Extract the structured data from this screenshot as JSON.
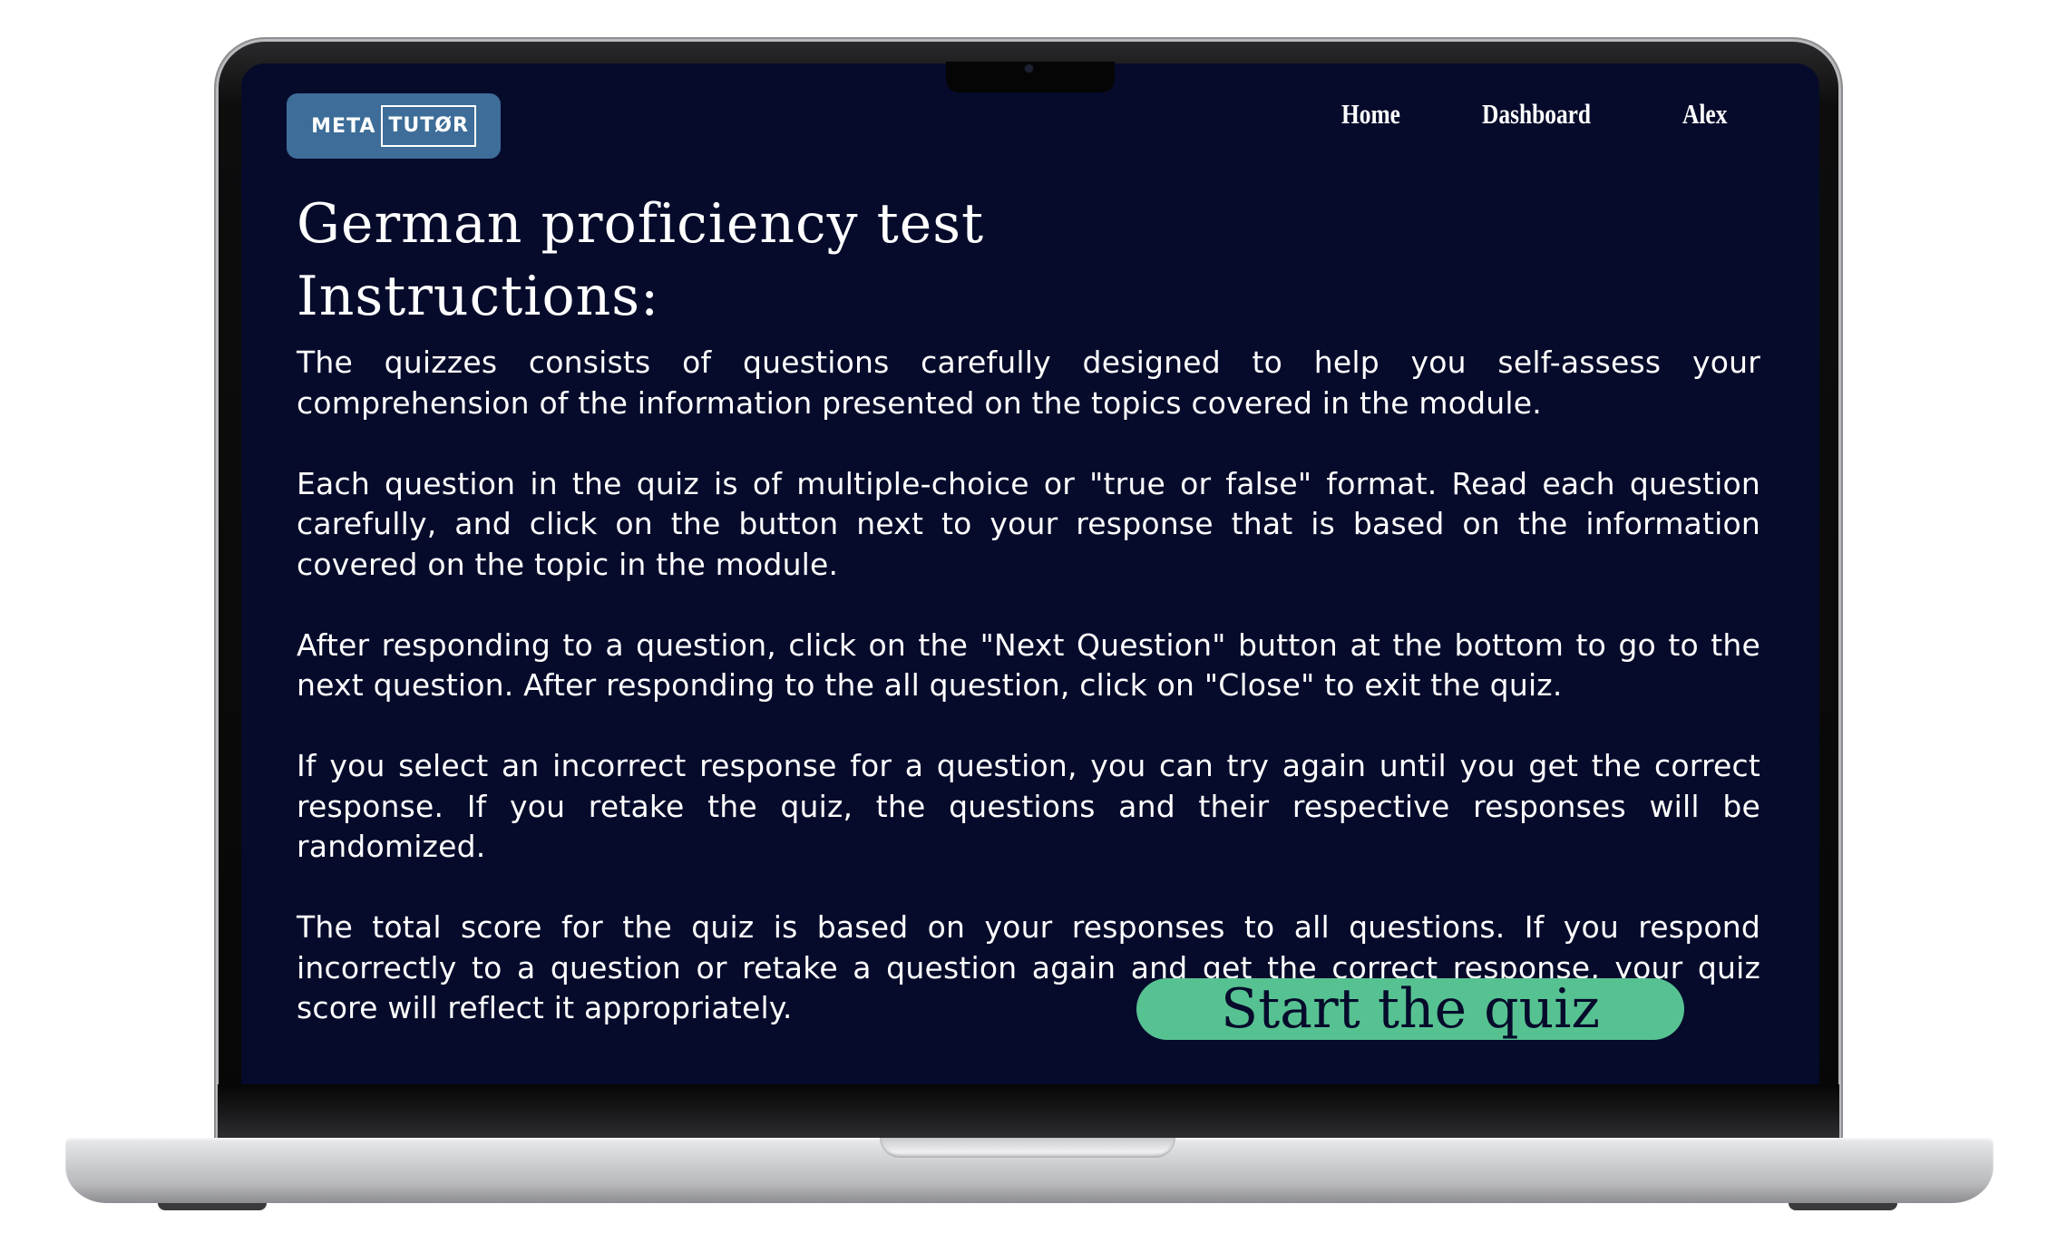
{
  "header": {
    "logo": {
      "part1": "META",
      "part2": "TUTØR"
    },
    "nav": [
      {
        "label": "Home"
      },
      {
        "label": "Dashboard"
      },
      {
        "label": "Alex"
      }
    ]
  },
  "main": {
    "title": "German proficiency test",
    "instructions_heading": "Instructions:",
    "paragraphs": [
      "The quizzes consists of questions carefully designed to help you self-assess your comprehension of the information presented on the topics covered in the module.",
      "Each question in the quiz is of multiple-choice or \"true or false\" format. Read each question carefully, and click on the button next to your response that is based on the information covered on the topic in the module.",
      "After responding to a question, click on the \"Next Question\" button at the bottom to go to the next question. After responding to the all question, click on \"Close\" to exit the quiz.",
      "If you select an incorrect response for a question, you can try again until you get the correct response. If you retake the quiz, the questions and their respective responses will be randomized.",
      "The total score for the quiz is based on your responses to all questions. If you respond incorrectly to a question or retake a question again and get the correct response, your quiz score will reflect it appropriately."
    ],
    "start_button": "Start the quiz"
  },
  "colors": {
    "screen_background": "#060b2b",
    "logo_background": "#3d6d98",
    "start_button": "#57c291",
    "text": "#ffffff"
  }
}
